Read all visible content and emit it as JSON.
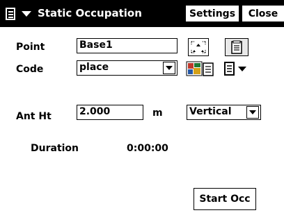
{
  "window": {
    "title": "Static Occupation",
    "settings_label": "Settings",
    "close_label": "Close"
  },
  "form": {
    "point_label": "Point",
    "point_value": "Base1",
    "code_label": "Code",
    "code_value": "place",
    "ant_ht_label": "Ant Ht",
    "ant_ht_value": "2.000",
    "ant_ht_unit": "m",
    "ant_method_value": "Vertical",
    "duration_label": "Duration",
    "duration_value": "0:00:00"
  },
  "actions": {
    "start_label": "Start Occ"
  },
  "icons": {
    "menu": "menu-list-icon",
    "point_select": "map-select-icon",
    "point_list": "list-icon",
    "code_library": "code-library-icon",
    "code_menu": "list-dropdown-icon"
  },
  "colors": {
    "titlebar": "#000000",
    "background": "#ffffff"
  }
}
